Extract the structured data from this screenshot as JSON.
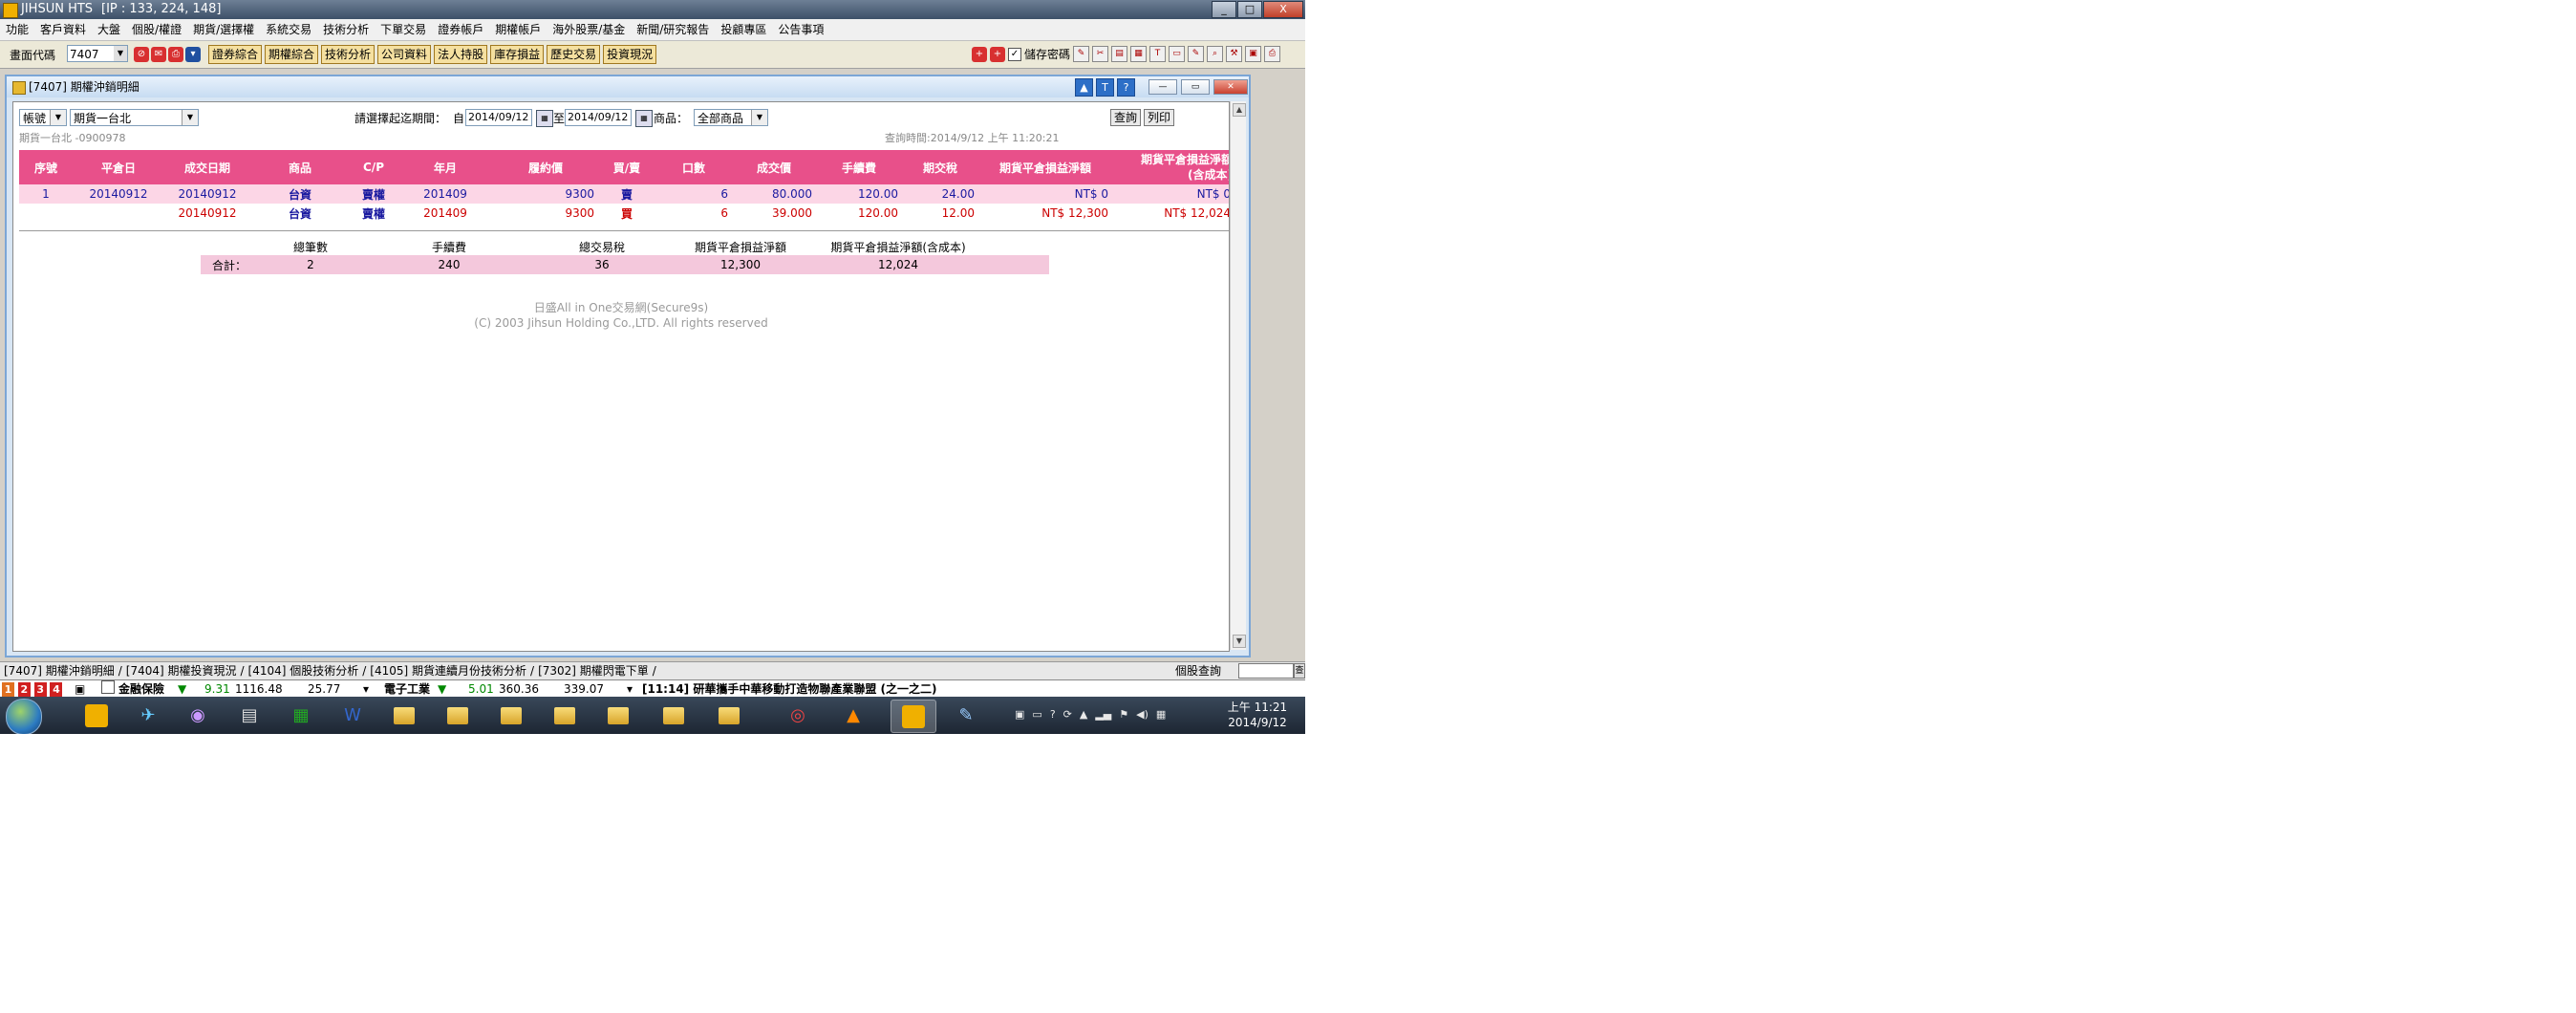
{
  "window": {
    "title": "JIHSUN HTS",
    "ip_info": "[IP : 133, 224, 148]",
    "controls": [
      "_",
      "□",
      "X"
    ]
  },
  "menu": [
    "功能",
    "客戶資料",
    "大盤",
    "個股/權證",
    "期貨/選擇權",
    "系統交易",
    "技術分析",
    "下單交易",
    "證券帳戶",
    "期權帳戶",
    "海外股票/基金",
    "新聞/研究報告",
    "投顧專區",
    "公告事項"
  ],
  "toolbar": {
    "screen_code_label": "畫面代碼",
    "screen_code_value": "7407",
    "buttons": [
      "證券綜合",
      "期權綜合",
      "技術分析",
      "公司資料",
      "法人持股",
      "庫存損益",
      "歷史交易",
      "投資現況"
    ],
    "save_password_label": "儲存密碼",
    "save_password_checked": true
  },
  "child_window": {
    "title": "[7407] 期權沖銷明細",
    "title_tools": [
      "▲",
      "T",
      "?"
    ]
  },
  "filters": {
    "account_type": "帳號",
    "account": "期貨一台北",
    "period_label": "請選擇起迄期間：",
    "from_label": "自",
    "from_date": "2014/09/12",
    "to_label": "至",
    "to_date": "2014/09/12",
    "product_label": "商品：",
    "product_value": "全部商品",
    "query_button": "查詢",
    "print_button": "列印",
    "account_info": "期貨一台北 -0900978",
    "query_time": "查詢時間:2014/9/12 上午 11:20:21"
  },
  "table": {
    "headers": [
      "序號",
      "平倉日",
      "成交日期",
      "商品",
      "C/P",
      "年月",
      "履約價",
      "買/賣",
      "口數",
      "成交價",
      "手續費",
      "期交稅",
      "期貨平倉損益淨額",
      "期貨平倉損益淨額(含成本)"
    ],
    "header_last_line1": "期貨平倉損益淨額",
    "header_last_line2": "(含成本)",
    "rows": [
      {
        "seq": "1",
        "close_date": "20140912",
        "trade_date": "20140912",
        "product": "台資",
        "cp": "賣權",
        "ym": "201409",
        "strike": "9300",
        "side": "賣",
        "qty": "6",
        "price": "80.000",
        "fee": "120.00",
        "tax": "24.00",
        "net": "NT$ 0",
        "net_cost": "NT$ 0"
      },
      {
        "seq": "",
        "close_date": "",
        "trade_date": "20140912",
        "product": "台資",
        "cp": "賣權",
        "ym": "201409",
        "strike": "9300",
        "side": "買",
        "qty": "6",
        "price": "39.000",
        "fee": "120.00",
        "tax": "12.00",
        "net": "NT$ 12,300",
        "net_cost": "NT$ 12,024"
      }
    ]
  },
  "summary": {
    "headers": [
      "總筆數",
      "手續費",
      "總交易稅",
      "期貨平倉損益淨額",
      "期貨平倉損益淨額(含成本)"
    ],
    "label": "合計：",
    "values": [
      "2",
      "240",
      "36",
      "12,300",
      "12,024"
    ]
  },
  "footer": {
    "line1": "日盛All in One交易網(Secure9s)",
    "line2": "(C) 2003 Jihsun Holding Co.,LTD. All rights reserved"
  },
  "mdi_tabs": [
    "[7407] 期權沖銷明細",
    "[7404] 期權投資現況",
    "[4104] 個股技術分析",
    "[4105] 期貨連續月份技術分析",
    "[7302] 期權閃電下單"
  ],
  "stock_query_label": "個股查詢",
  "ticker": {
    "page_nums": [
      "1",
      "2",
      "3",
      "4"
    ],
    "item1_name": "金融保險",
    "item1_change": "9.31",
    "item1_value": "1116.48",
    "item1_volume": "25.77",
    "item2_name": "電子工業",
    "item2_change": "5.01",
    "item2_value": "360.36",
    "item2_volume": "339.07",
    "news": "[11:14] 研華攜手中華移動打造物聯產業聯盟 (之一之二)"
  },
  "taskbar": {
    "time": "上午 11:21",
    "date": "2014/9/12"
  }
}
